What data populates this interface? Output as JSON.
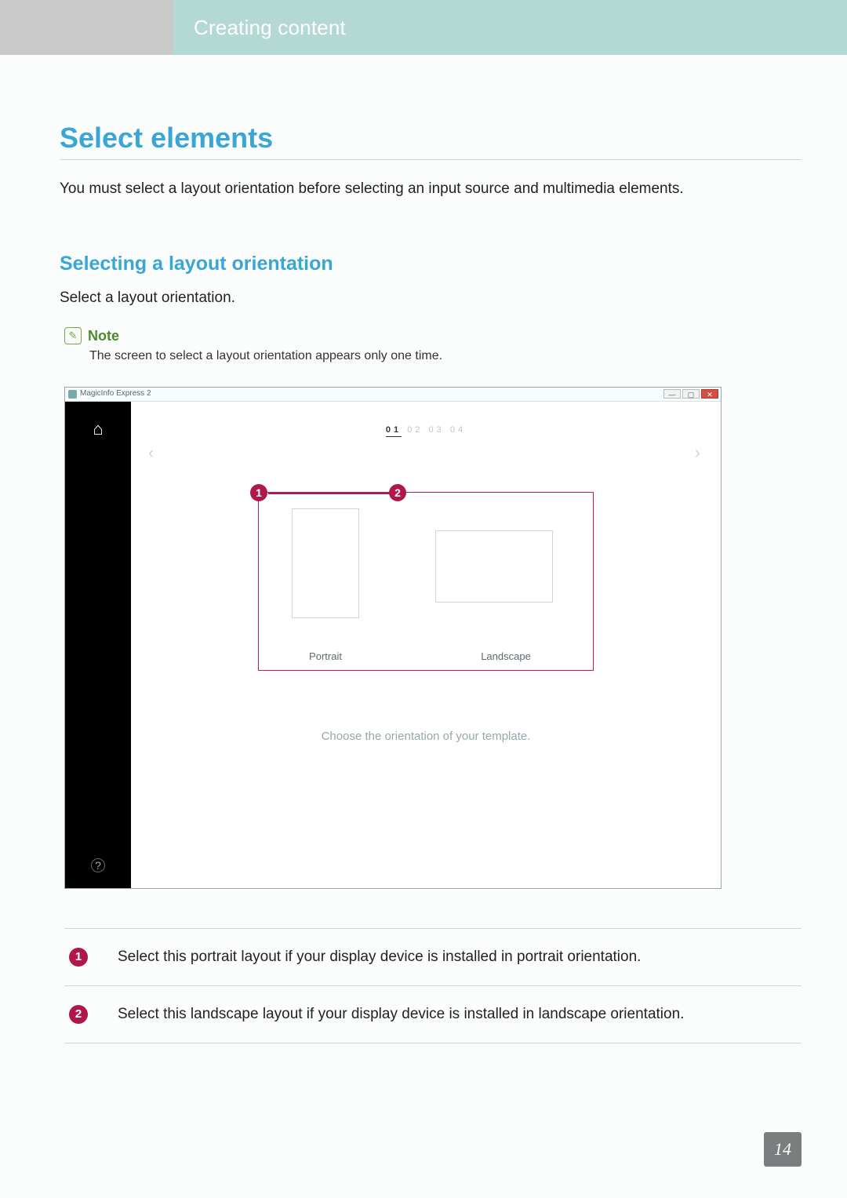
{
  "banner": {
    "breadcrumb": "Creating content"
  },
  "h1": "Select elements",
  "intro": "You must select a layout orientation before selecting an input source and multimedia elements.",
  "h2": "Selecting a layout orientation",
  "instruction_short": "Select a layout orientation.",
  "note": {
    "label": "Note",
    "text": "The screen to select a layout orientation appears only one time."
  },
  "app": {
    "title": "MagicInfo Express 2",
    "win": {
      "min": "—",
      "max": "▢",
      "close": "✕"
    },
    "home_icon": "⌂",
    "help_icon": "?",
    "steps": {
      "s1": "01",
      "s2": "02",
      "s3": "03",
      "s4": "04",
      "chev_l": "‹",
      "chev_r": "›"
    },
    "options": {
      "portrait": "Portrait",
      "landscape": "Landscape"
    },
    "callouts": {
      "c1": "1",
      "c2": "2"
    },
    "hint": "Choose the orientation of your template."
  },
  "legend": {
    "r1": {
      "num": "1",
      "text": "Select this portrait layout if your display device is installed in portrait orientation."
    },
    "r2": {
      "num": "2",
      "text": "Select this landscape layout if your display device is installed in landscape orientation."
    }
  },
  "page_number": "14"
}
